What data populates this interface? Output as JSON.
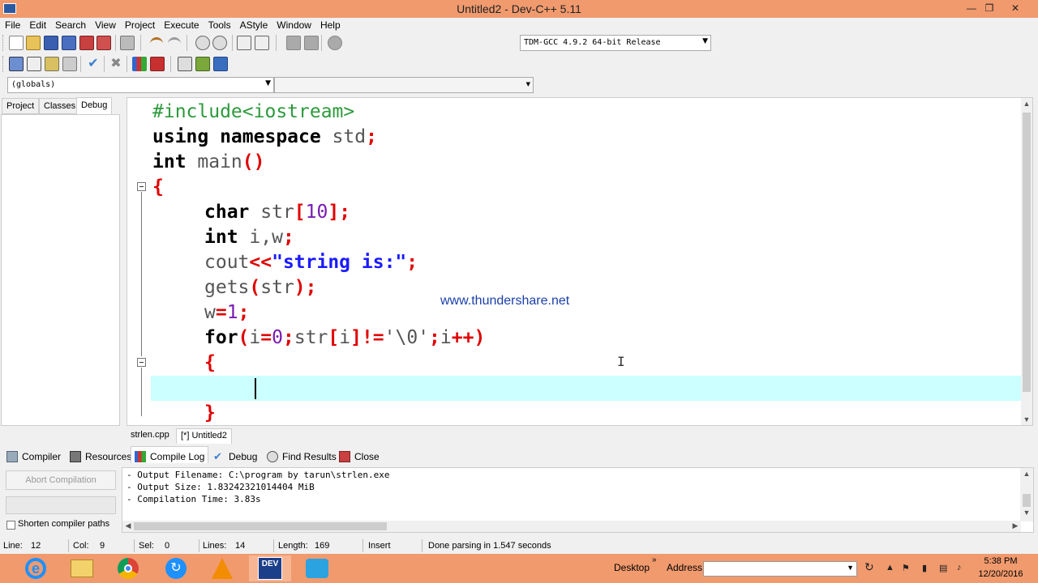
{
  "window": {
    "title": "Untitled2 - Dev-C++ 5.11"
  },
  "menu": [
    "File",
    "Edit",
    "Search",
    "View",
    "Project",
    "Execute",
    "Tools",
    "AStyle",
    "Window",
    "Help"
  ],
  "compiler_select": {
    "value": "TDM-GCC 4.9.2 64-bit Release"
  },
  "scope_select": {
    "value": "(globals)",
    "second": ""
  },
  "left_tabs": [
    "Project",
    "Classes",
    "Debug"
  ],
  "file_tabs": [
    "strlen.cpp",
    "[*] Untitled2"
  ],
  "code": {
    "l1": "#include<iostream>",
    "l2_kw": "using namespace",
    "l2_id": " std",
    "l2_end": ";",
    "l3_kw": "int",
    "l3_id": " main",
    "l3_paren": "()",
    "l4": "{",
    "l5_kw": "char",
    "l5_id": " str",
    "l5_o1": "[",
    "l5_num": "10",
    "l5_o2": "];",
    "l6_kw": "int",
    "l6_id": " i,w",
    "l6_end": ";",
    "l7_id": "cout",
    "l7_op": "<<",
    "l7_str": "\"string is:\"",
    "l7_end": ";",
    "l8_id": "gets",
    "l8_o1": "(",
    "l8_id2": "str",
    "l8_o2": ");",
    "l9_id": "w",
    "l9_op": "=",
    "l9_num": "1",
    "l9_end": ";",
    "l10_kw": "for",
    "l10_o1": "(",
    "l10_a": "i",
    "l10_eq": "=",
    "l10_n0": "0",
    "l10_semi": ";",
    "l10_b": "str",
    "l10_br1": "[",
    "l10_c": "i",
    "l10_br2": "]!=",
    "l10_chr": "'\\0'",
    "l10_semi2": ";",
    "l10_d": "i",
    "l10_inc": "++)",
    "l11": "{",
    "l13": "}"
  },
  "watermark": "www.thundershare.net",
  "bottom_tabs": [
    "Compiler",
    "Resources",
    "Compile Log",
    "Debug",
    "Find Results",
    "Close"
  ],
  "bottom_left": {
    "abort": "Abort Compilation",
    "shorten": "Shorten compiler paths"
  },
  "log": [
    "- Output Filename: C:\\program by tarun\\strlen.exe",
    "- Output Size: 1.83242321014404 MiB",
    "- Compilation Time: 3.83s"
  ],
  "status": {
    "line_label": "Line:",
    "line": "12",
    "col_label": "Col:",
    "col": "9",
    "sel_label": "Sel:",
    "sel": "0",
    "lines_label": "Lines:",
    "lines": "14",
    "length_label": "Length:",
    "length": "169",
    "mode": "Insert",
    "message": "Done parsing in 1.547 seconds"
  },
  "taskbar": {
    "desktop": "Desktop",
    "address": "Address",
    "time": "5:38 PM",
    "date": "12/20/2016",
    "dev_label": "DEV"
  },
  "colors": {
    "titlebar": "#f09a6e",
    "current_line": "#ccffff",
    "string": "#1a1aff",
    "operator": "#e00000",
    "preprocessor": "#2d9a3c"
  }
}
